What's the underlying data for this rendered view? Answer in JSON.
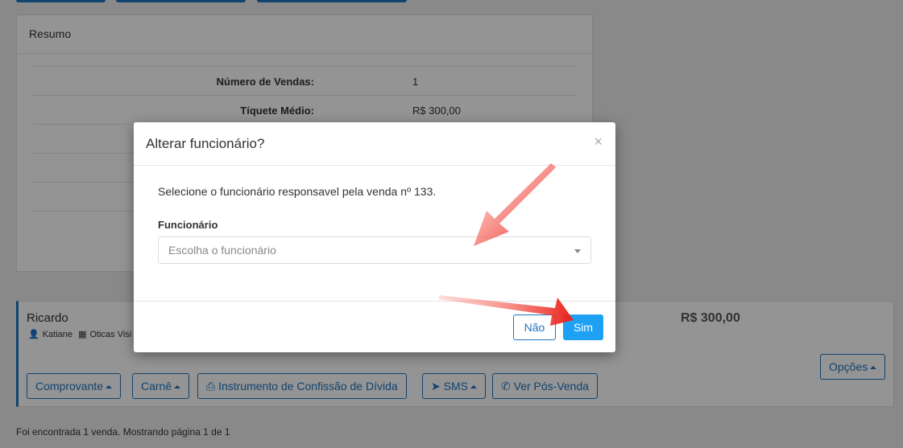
{
  "resumo": {
    "title": "Resumo",
    "rows": [
      {
        "label": "Número de Vendas:",
        "value": "1"
      },
      {
        "label": "Tíquete Médio:",
        "value": "R$ 300,00"
      },
      {
        "label": "",
        "value": ""
      },
      {
        "label": "",
        "value": ""
      },
      {
        "label": "",
        "value": ""
      }
    ]
  },
  "sale": {
    "client": "Ricardo",
    "seller": "Katiane",
    "store": "Oticas Visi",
    "value": "R$ 300,00",
    "buttons": {
      "comprovante": "Comprovante",
      "carne": "Carnê",
      "instrumento": "Instrumento de Confissão de Dívida",
      "sms": "SMS",
      "pos_venda": "Ver Pós-Venda",
      "opcoes": "Opções"
    }
  },
  "footer": {
    "text": "Foi encontrada 1 venda. Mostrando página 1 de 1"
  },
  "modal": {
    "title": "Alterar funcionário?",
    "close": "×",
    "message": "Selecione o funcionário responsavel pela venda nº 133.",
    "field_label": "Funcionário",
    "select_placeholder": "Escolha o funcionário",
    "nao": "Não",
    "sim": "Sim"
  },
  "colors": {
    "primary": "#1e74c0",
    "sim": "#1ea1f2",
    "arrow": "#e8221a"
  }
}
